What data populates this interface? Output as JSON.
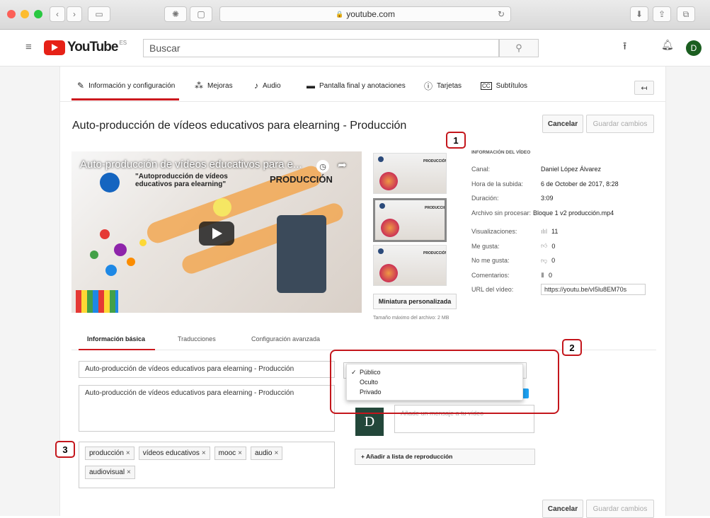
{
  "browser": {
    "url": "youtube.com",
    "lock": "lock-icon"
  },
  "header": {
    "brand": "YouTube",
    "region": "ES",
    "search_placeholder": "Buscar",
    "avatar": "D"
  },
  "tabs": [
    {
      "label": "Información y configuración",
      "icon": "pencil-icon"
    },
    {
      "label": "Mejoras",
      "icon": "magic-wand-icon"
    },
    {
      "label": "Audio",
      "icon": "music-note-icon"
    },
    {
      "label": "Pantalla final y anotaciones",
      "icon": "screen-icon"
    },
    {
      "label": "Tarjetas",
      "icon": "info-icon"
    },
    {
      "label": "Subtítulos",
      "icon": "cc-icon"
    }
  ],
  "page": {
    "title": "Auto-producción de vídeos educativos para elearning - Producción",
    "cancel": "Cancelar",
    "save": "Guardar cambios"
  },
  "video": {
    "title": "Auto-producción de vídeos educativos para e...",
    "subtitle1": "\"Autoproducción de vídeos",
    "subtitle2": "educativos para elearning\"",
    "tag": "PRODUCCIÓN"
  },
  "thumbs": {
    "custom_button": "Miniatura personalizada",
    "max_size": "Tamaño máximo del archivo: 2 MB"
  },
  "info": {
    "heading": "INFORMACIÓN DEL VÍDEO",
    "rows": [
      {
        "label": "Canal:",
        "value": "Daniel López Álvarez"
      },
      {
        "label": "Hora de la subida:",
        "value": "6 de October de 2017, 8:28"
      },
      {
        "label": "Duración:",
        "value": "3:09"
      },
      {
        "label": "Archivo sin procesar:",
        "value": "Bloque 1 v2 producción.mp4"
      },
      {
        "label": "Visualizaciones:",
        "value": "11"
      },
      {
        "label": "Me gusta:",
        "value": "0"
      },
      {
        "label": "No me gusta:",
        "value": "0"
      },
      {
        "label": "Comentarios:",
        "value": "0"
      }
    ],
    "url_label": "URL del vídeo:",
    "url_value": "https://youtu.be/vI5lu8EM70s"
  },
  "lower_tabs": [
    "Información básica",
    "Traducciones",
    "Configuración avanzada"
  ],
  "form": {
    "title_value": "Auto-producción de vídeos educativos para elearning -  Producción",
    "description_value": "Auto-producción de vídeos educativos para elearning -  Producción",
    "tags": [
      "producción",
      "vídeos educativos",
      "mooc",
      "audio",
      "audiovisual"
    ],
    "privacy_options": [
      "Público",
      "Oculto",
      "Privado"
    ],
    "privacy_selected": "Público",
    "message_placeholder": "Añade un mensaje a tu vídeo",
    "avatar_letter": "D",
    "add_playlist": "+ Añadir a lista de reproducción"
  },
  "annotations": [
    "1",
    "2",
    "3"
  ],
  "colors": {
    "accent": "#cc181e",
    "annotation": "#c4161c",
    "youtube_red": "#e62117"
  }
}
